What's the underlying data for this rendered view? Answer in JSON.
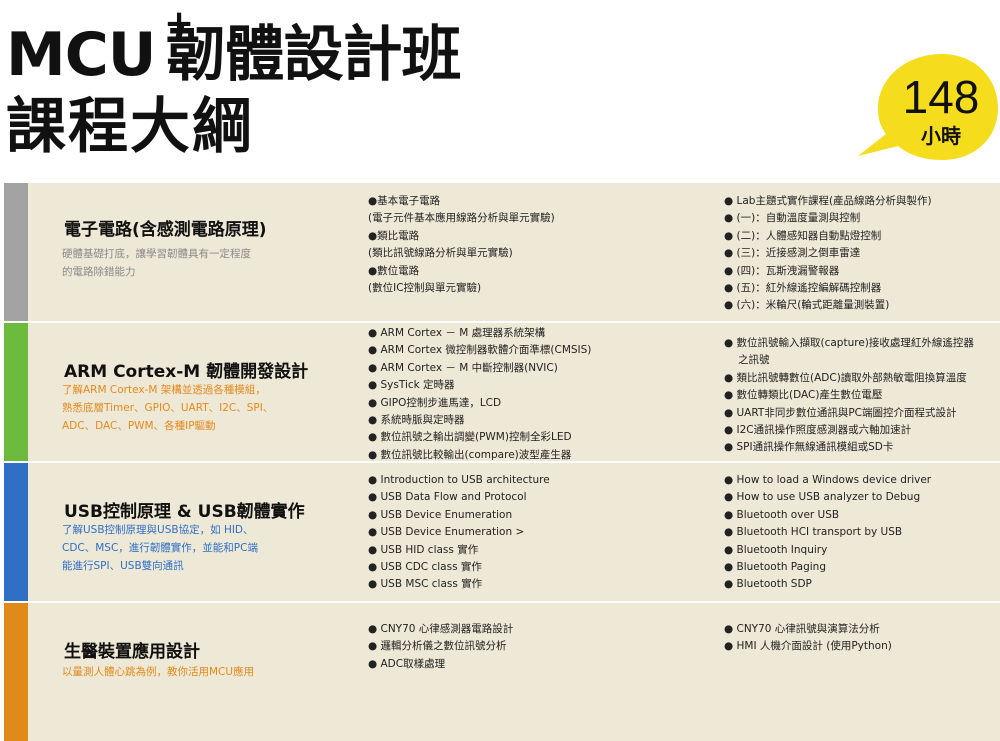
{
  "header": {
    "title_mcu": "MCU",
    "title_plus": "+",
    "title_rest": "韌體設計班",
    "subtitle": "課程大綱"
  },
  "badge": {
    "hours": "148",
    "unit": "小時",
    "color": "#f5dd1e"
  },
  "sections": [
    {
      "color": "#a3a3a3",
      "desc_color": "#8a8a8a",
      "title": "電子電路(含感測電路原理)",
      "desc": "硬體基礎打底，讓學習韌體具有一定程度\n的電路除錯能力",
      "left_items": [
        "●基本電子電路",
        "(電子元件基本應用線路分析與單元實驗)",
        "●類比電路",
        "(類比訊號線路分析與單元實驗)",
        "●數位電路",
        "(數位IC控制與單元實驗)"
      ],
      "right_items": [
        "● Lab主題式實作課程(產品線路分析與製作)",
        "● (一)：自動溫度量測與控制",
        "● (二)：人體感知器自動點燈控制",
        "● (三)：近接感測之倒車雷達",
        "● (四)：瓦斯洩漏警報器",
        "● (五)：紅外線遙控編解碼控制器",
        "● (六)：米輪尺(輪式距離量測裝置)"
      ]
    },
    {
      "color": "#6cbb3c",
      "desc_color": "#e48a1c",
      "title": "ARM Cortex-M 韌體開發設計",
      "desc": "了解ARM Cortex-M 架構並透過各種模組，\n熟悉底層Timer、GPIO、UART、I2C、SPI、\nADC、DAC、PWM、各種IP驅動",
      "left_items": [
        "● ARM Cortex － M 處理器系統架構",
        "● ARM Cortex 微控制器軟體介面準標(CMSIS)",
        "● ARM Cortex － M 中斷控制器(NVIC)",
        "● SysTick 定時器",
        "● GIPO控制步進馬達，LCD",
        "● 系統時脈與定時器",
        "● 數位訊號之輸出調變(PWM)控制全彩LED",
        "● 數位訊號比較輸出(compare)波型產生器"
      ],
      "right_items": [
        "● 數位訊號輸入擷取(capture)接收處理紅外線遙控器\n之訊號",
        "● 類比訊號轉數位(ADC)讀取外部熱敏電阻換算溫度",
        "● 數位轉類比(DAC)產生數位電壓",
        "● UART非同步數位通訊與PC端圖控介面程式設計",
        "● I2C通訊操作照度感測器或六軸加速計",
        "● SPI通訊操作無線通訊模組或SD卡"
      ]
    },
    {
      "color": "#2f6fc6",
      "desc_color": "#2f6fc6",
      "title": "USB控制原理 & USB韌體實作",
      "desc": "了解USB控制原理與USB協定，如 HID、\nCDC、MSC，進行韌體實作，並能和PC端\n能進行SPI、USB雙向通訊",
      "left_items": [
        "● Introduction to USB architecture",
        "● USB Data Flow and Protocol",
        "● USB Device Enumeration",
        "● USB Device Enumeration >",
        "● USB HID class 實作",
        "● USB CDC class 實作",
        "● USB MSC class 實作"
      ],
      "right_items": [
        "● How to load a Windows device driver",
        "● How to use USB analyzer to Debug",
        "● Bluetooth over USB",
        "● Bluetooth HCI transport by USB",
        "● Bluetooth Inquiry",
        "● Bluetooth Paging",
        "● Bluetooth SDP"
      ]
    },
    {
      "color": "#e08a1a",
      "desc_color": "#e08a1a",
      "title": "生醫裝置應用設計",
      "desc": "以量測人體心跳為例，教你活用MCU應用",
      "left_items": [
        "● CNY70 心律感測器電路設計",
        "● 邏輯分析儀之數位訊號分析",
        "● ADC取樣處理"
      ],
      "right_items": [
        "● CNY70 心律訊號與演算法分析",
        "● HMI 人機介面設計 (使用Python)"
      ]
    }
  ]
}
